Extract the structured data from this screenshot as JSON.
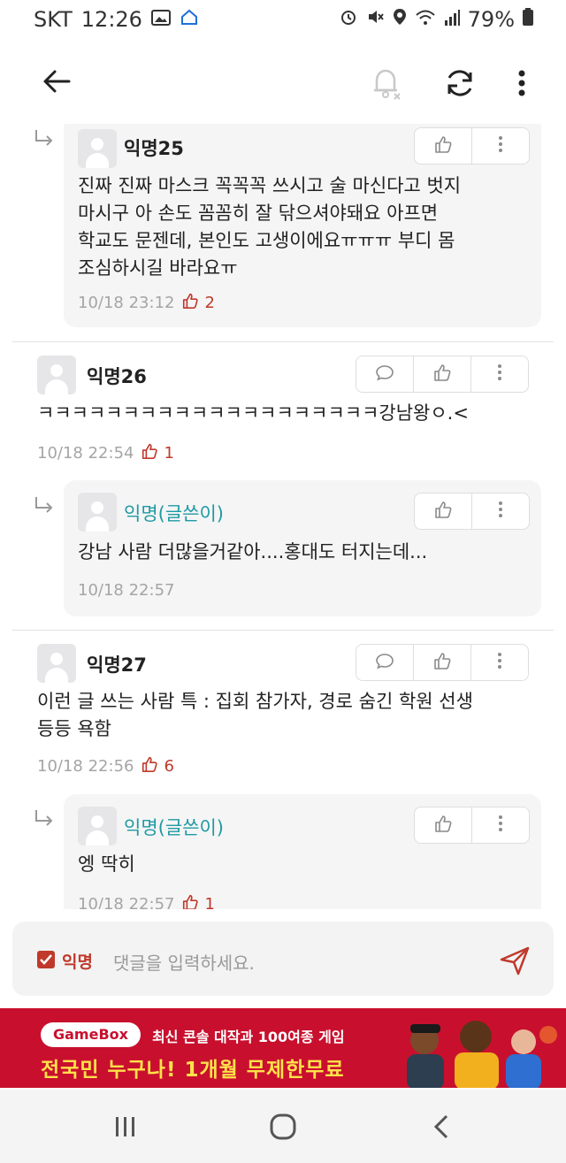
{
  "status_bar": {
    "carrier": "SKT",
    "time": "12:26",
    "battery": "79%"
  },
  "colors": {
    "accent": "#c0392b",
    "op_name": "#1f9aa2",
    "banner_bg": "#c8102e"
  },
  "comments": [
    {
      "type": "reply",
      "author": "익명25",
      "text_lines": [
        "진짜 진짜 마스크 꼭꼭꼭 쓰시고 술 마신다고 벗지",
        "마시구 아 손도 꼼꼼히 잘 닦으셔야돼요 아프면",
        "학교도 문젠데, 본인도 고생이에요ㅠㅠㅠ 부디 몸",
        "조심하시길 바라요ㅠ"
      ],
      "time": "10/18 23:12",
      "likes": "2"
    },
    {
      "type": "comment",
      "author": "익명26",
      "text_lines": [
        "ㅋㅋㅋㅋㅋㅋㅋㅋㅋㅋㅋㅋㅋㅋㅋㅋㅋㅋㅋㅋ강남왕ㅇ.<"
      ],
      "time": "10/18 22:54",
      "likes": "1"
    },
    {
      "type": "reply",
      "author": "익명(글쓴이)",
      "text_lines": [
        "강남 사람 더많을거같아....홍대도 터지는데..."
      ],
      "time": "10/18 22:57",
      "likes": ""
    },
    {
      "type": "comment",
      "author": "익명27",
      "text_lines": [
        "이런 글 쓰는 사람 특 : 집회 참가자, 경로 숨긴 학원 선생",
        "등등 욕함"
      ],
      "time": "10/18 22:56",
      "likes": "6"
    },
    {
      "type": "reply",
      "author": "익명(글쓴이)",
      "text_lines": [
        "엥 딱히"
      ],
      "time": "10/18 22:57",
      "likes": "1"
    }
  ],
  "input_bar": {
    "anon_label": "익명",
    "placeholder": "댓글을 입력하세요."
  },
  "banner": {
    "logo": "GameBox",
    "line1": "최신 콘솔 대작과 100여종 게임",
    "line2": "전국민 누구나! 1개월 무제한무료"
  },
  "icons": {
    "back": "arrow-left-icon",
    "notify_off": "bell-off-icon",
    "refresh": "refresh-icon",
    "more": "more-vertical-icon",
    "comment": "speech-bubble-icon",
    "like": "thumbs-up-icon",
    "send": "paper-plane-icon"
  }
}
